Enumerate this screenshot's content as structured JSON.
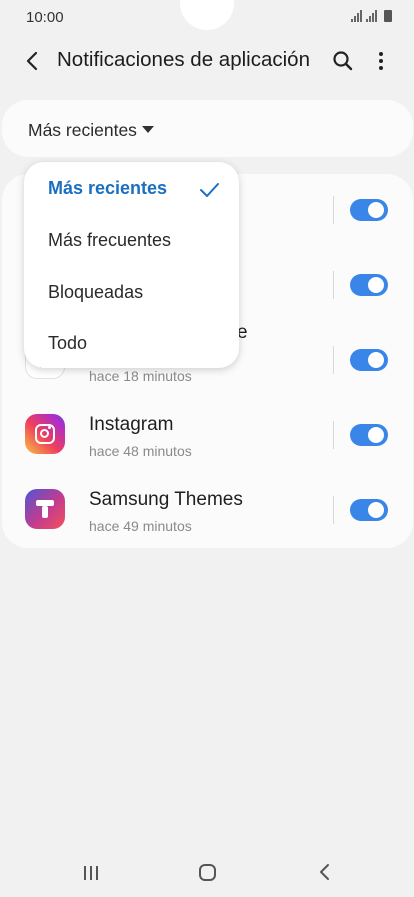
{
  "status_bar": {
    "time": "10:00"
  },
  "header": {
    "title": "Notificaciones de aplicación",
    "back_icon": "chevron-left-icon",
    "search_icon": "search-icon",
    "more_icon": "more-vert-icon"
  },
  "sort": {
    "label": "Más recientes"
  },
  "dropdown": {
    "items": [
      {
        "label": "Más recientes",
        "selected": true
      },
      {
        "label": "Más frecuentes",
        "selected": false
      },
      {
        "label": "Bloqueadas",
        "selected": false
      },
      {
        "label": "Todo",
        "selected": false
      }
    ]
  },
  "apps": [
    {
      "name": "",
      "time": "",
      "enabled": true
    },
    {
      "name": "",
      "time": "",
      "enabled": true
    },
    {
      "name": "e",
      "time": "hace 18 minutos",
      "enabled": true,
      "icon": "google-play-store-icon"
    },
    {
      "name": "Instagram",
      "time": "hace 48 minutos",
      "enabled": true,
      "icon": "instagram-icon"
    },
    {
      "name": "Samsung Themes",
      "time": "hace 49 minutos",
      "enabled": true,
      "icon": "samsung-themes-icon"
    }
  ],
  "colors": {
    "accent": "#3a86e8",
    "selected_text": "#1a6fc0",
    "background": "#f1f1f1"
  }
}
